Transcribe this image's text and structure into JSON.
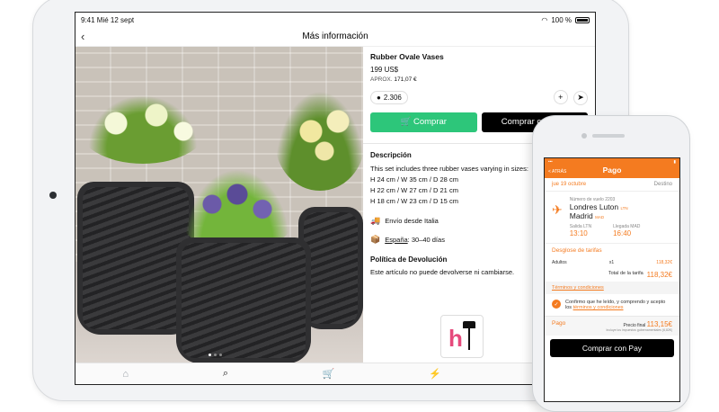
{
  "ipad": {
    "status": {
      "time_date": "9:41  Mié 12 sept",
      "battery": "100 %"
    },
    "nav": {
      "title": "Más información"
    },
    "product": {
      "title": "Rubber Ovale Vases",
      "price": "199 US$",
      "approx_label": "APROX.",
      "approx_value": "171,07 €",
      "likes": "2.306",
      "buy_label": "Comprar",
      "buy_with_label": "Comprar con  Pay"
    },
    "description": {
      "heading": "Descripción",
      "intro": "This set includes three rubber vases varying in sizes:",
      "sizes": [
        "H 24 cm / W 35 cm / D 28 cm",
        "H 22 cm / W 27 cm / D 21 cm",
        "H 18 cm / W 23 cm / D 15 cm"
      ],
      "shipping": "Envío desde Italia",
      "delivery_country": "España",
      "delivery_days": ": 30–40 días"
    },
    "policy": {
      "heading": "Política de Devolución",
      "text": "Este artículo no puede devolverse ni cambiarse."
    },
    "tabs": [
      "home-icon",
      "search-icon",
      "cart-icon",
      "flash-icon",
      "profile-icon"
    ]
  },
  "iphone": {
    "nav": {
      "back": "< ATRÁS",
      "title": "Pago"
    },
    "date": "jue 19 octubre",
    "destination_label": "Destino",
    "flight_number": "Número de vuelo 2203",
    "origin": "Londres Luton",
    "origin_code": "LTN",
    "destination": "Madrid",
    "destination_code": "MAD",
    "depart_label": "Salida LTN",
    "depart_time": "13:10",
    "arrive_label": "Llegada MAD",
    "arrive_time": "16:40",
    "breakdown_label": "Desglose de tarifas",
    "adults_label": "Adultos",
    "adults_qty": "x1",
    "adults_amount": "118,32€",
    "total_label": "Total de la tarifa",
    "total_amount": "118,32€",
    "terms_label": "Términos y condiciones",
    "confirm_text": "Confirmo que he leído, y comprendo y acepto los",
    "confirm_link": "términos y condiciones",
    "pay_label": "Pago",
    "final_label": "Precio final",
    "final_amount": "113,15€",
    "final_note": "Incluye los impuestos gubernamentales (6,82€)",
    "apple_pay": "Comprar con  Pay"
  },
  "colors": {
    "accent_green": "#2dc67a",
    "accent_orange": "#f47b20"
  }
}
